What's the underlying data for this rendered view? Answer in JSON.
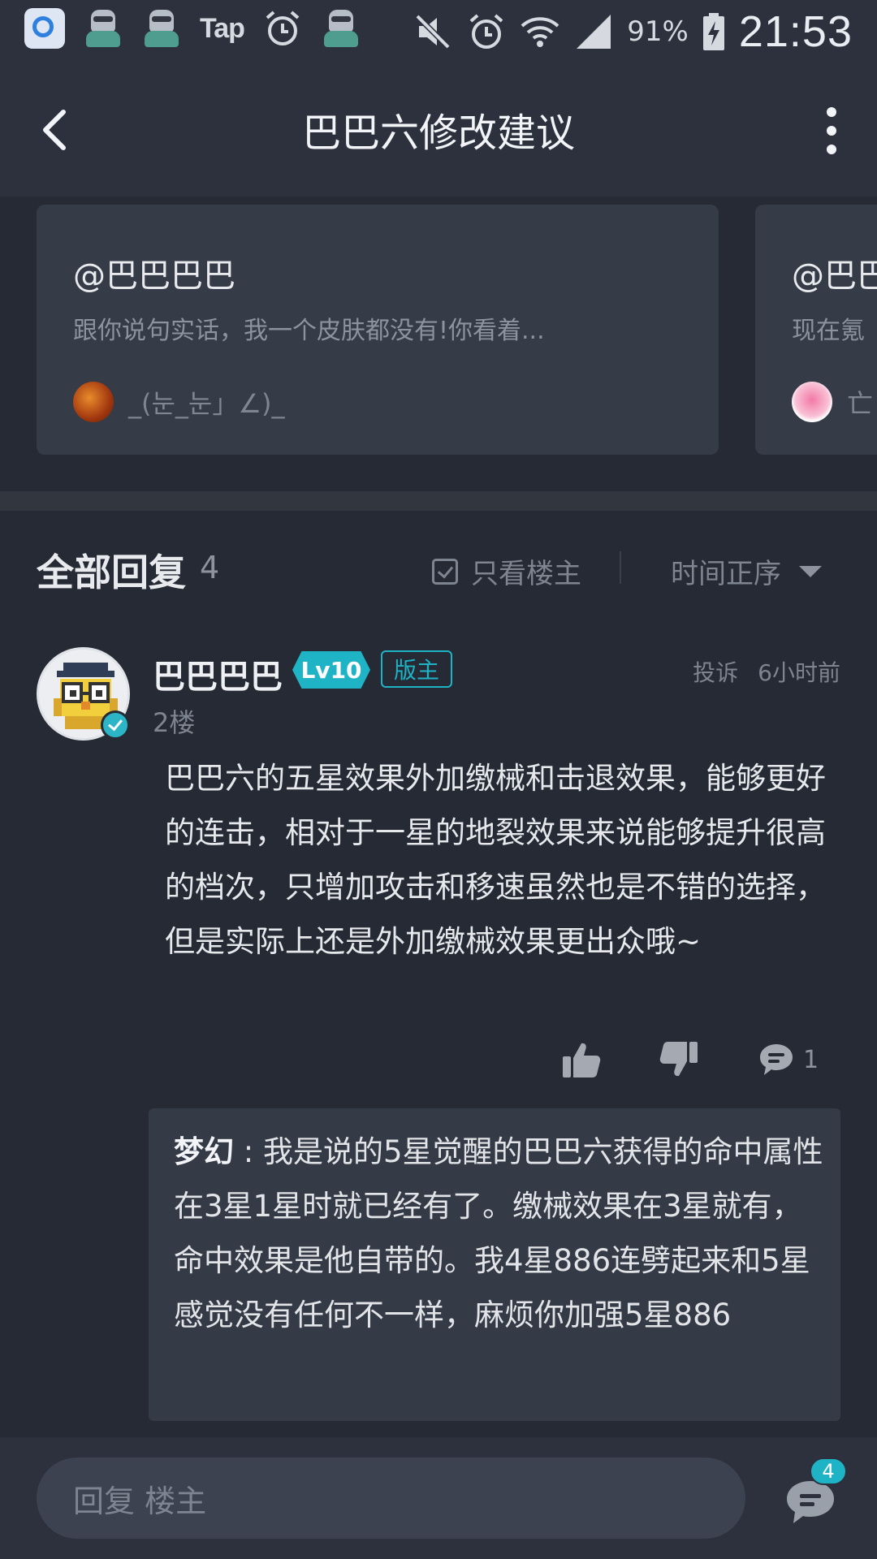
{
  "status_bar": {
    "tap_label": "Tap",
    "battery": "91%",
    "time": "21:53",
    "icons": [
      "qq-browser-icon",
      "avatar-icon",
      "avatar-icon",
      "tap-icon",
      "alarm-icon",
      "avatar-icon",
      "mute-icon",
      "alarm-icon",
      "wifi-icon",
      "signal-icon",
      "battery-charging-icon"
    ]
  },
  "header": {
    "title": "巴巴六修改建议"
  },
  "related_posts": [
    {
      "title": "@巴巴巴巴",
      "excerpt": "跟你说句实话，我一个皮肤都没有!你看着...",
      "user": "_(눈_눈」∠)_"
    },
    {
      "title": "@巴巴",
      "excerpt": "现在氪",
      "user": "亡"
    }
  ],
  "replies_header": {
    "title": "全部回复",
    "count": "4",
    "op_only_label": "只看楼主",
    "sort_label": "时间正序"
  },
  "reply": {
    "author": "巴巴巴巴",
    "level": "Lv10",
    "role": "版主",
    "report_label": "投诉",
    "time": "6小时前",
    "floor": "2楼",
    "content": "巴巴六的五星效果外加缴械和击退效果，能够更好的连击，相对于一星的地裂效果来说能够提升很高的档次，只增加攻击和移速虽然也是不错的选择，但是实际上还是外加缴械效果更出众哦~",
    "comment_count": "1",
    "sub_reply": {
      "author": "梦幻",
      "separator": " : ",
      "text": "我是说的5星觉醒的巴巴六获得的命中属性在3星1星时就已经有了。缴械效果在3星就有，命中效果是他自带的。我4星886连劈起来和5星感觉没有任何不一样，麻烦你加强5星886"
    }
  },
  "bottom_bar": {
    "input_placeholder": "回复  楼主",
    "comment_badge": "4"
  },
  "colors": {
    "background": "#252a35",
    "bar": "#2c313d",
    "card": "#353b47",
    "accent": "#1fb3c6"
  }
}
